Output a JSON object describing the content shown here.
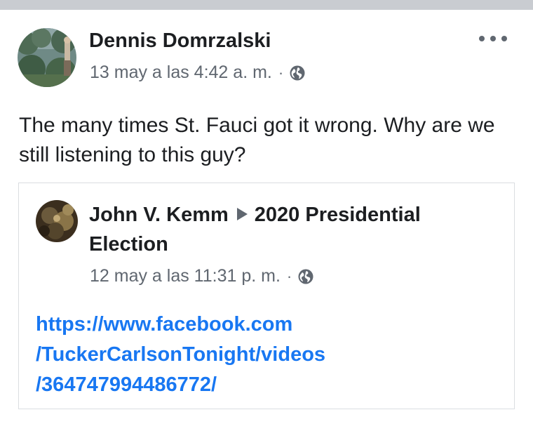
{
  "post": {
    "author": "Dennis Domrzalski",
    "timestamp": "13 may a las 4:42 a. m.",
    "separator": "·",
    "privacy_icon": "globe-icon",
    "more_icon": "more-options-icon",
    "text": "The many times St. Fauci got it wrong. Why are we still listening to this guy?"
  },
  "shared_post": {
    "author": "John V. Kemm",
    "arrow_icon": "triangle-right-icon",
    "group": "2020 Presidential Election",
    "timestamp": "12 may a las 11:31 p. m.",
    "separator": "·",
    "privacy_icon": "globe-icon",
    "link_lines": [
      "https://www.facebook.com",
      "/TuckerCarlsonTonight/videos",
      "/364747994486772/"
    ]
  },
  "colors": {
    "link": "#1877f2",
    "secondary_text": "#606770",
    "primary_text": "#1c1e21",
    "border": "#dadde1",
    "top_bar": "#c9ccd1"
  }
}
